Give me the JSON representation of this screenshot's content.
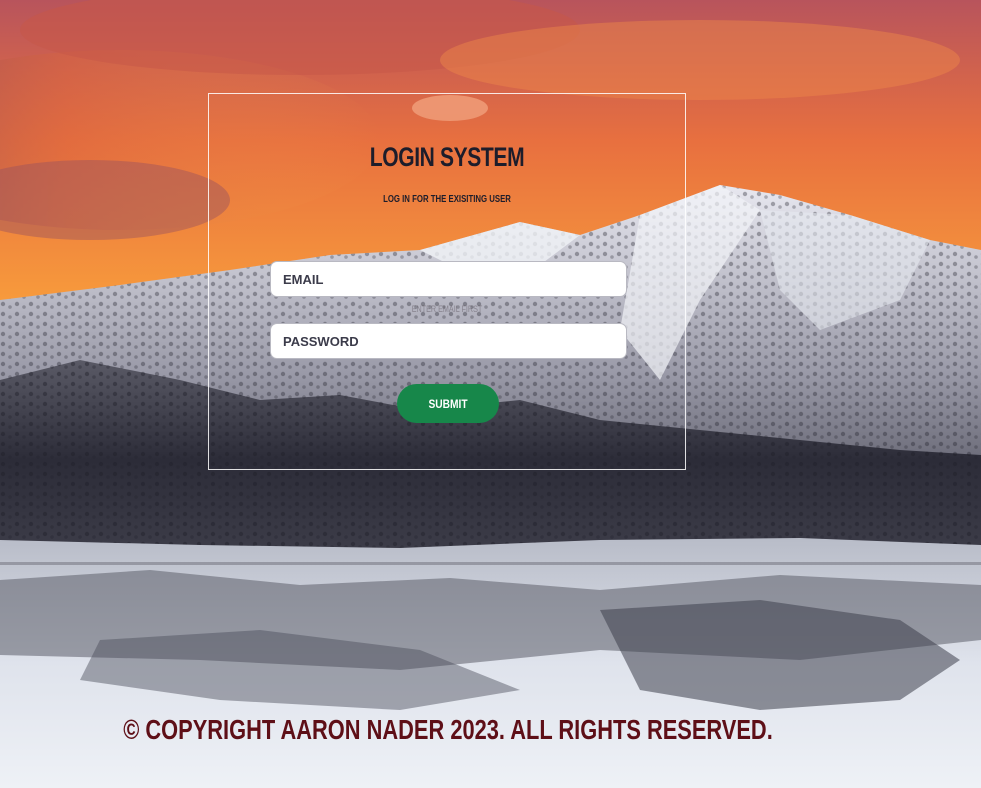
{
  "login": {
    "title": "LOGIN SYSTEM",
    "subtitle": "LOG IN FOR THE EXISITING USER",
    "email_placeholder": "EMAIL",
    "password_placeholder": "PASSWORD",
    "hint": "ENTER EMAIL FIRST",
    "submit_label": "SUBMIT"
  },
  "footer": {
    "copyright": "© COPYRIGHT AARON NADER 2023. ALL RIGHTS RESERVED."
  },
  "colors": {
    "submit": "#17874a",
    "copyright": "#5e0f17",
    "title": "#1d1d2b"
  },
  "background": {
    "description_icon": "mountain-sunset-image"
  }
}
